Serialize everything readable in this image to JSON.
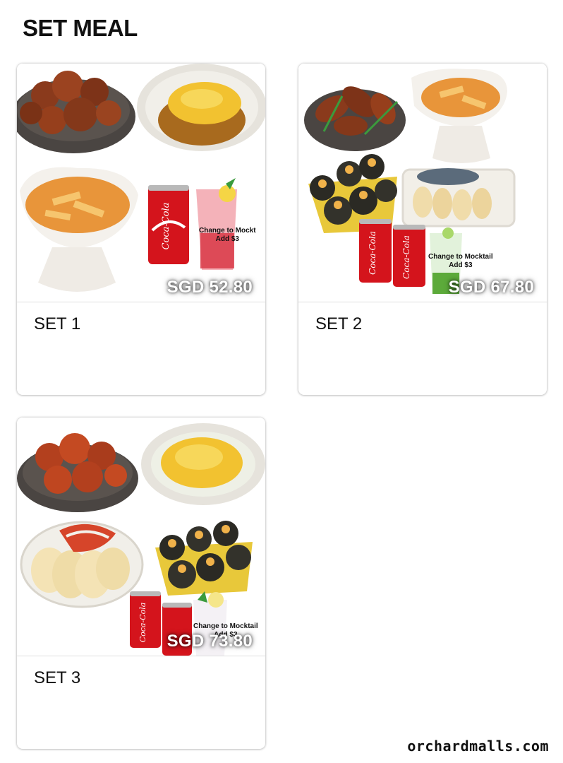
{
  "page": {
    "section_title": "SET MEAL",
    "watermark": "orchardmalls.com"
  },
  "sets": [
    {
      "name": "SET 1",
      "price": "SGD 52.80",
      "mocktail_line1": "Change to Mockt",
      "mocktail_line2": "Add $3",
      "soda_label": "Coca-Cola"
    },
    {
      "name": "SET 2",
      "price": "SGD 67.80",
      "mocktail_line1": "Change to Mocktail",
      "mocktail_line2": "Add $3",
      "soda_label": "Coca-Cola"
    },
    {
      "name": "SET 3",
      "price": "SGD 73.80",
      "mocktail_line1": "Change to Mocktail",
      "mocktail_line2": "Add $3",
      "soda_label": "Coca-Cola"
    }
  ],
  "colors": {
    "fried_chicken": "#8a3a1c",
    "sauce_chicken": "#b3401e",
    "cheese": "#f2c230",
    "curry": "#e8953a",
    "coke_red": "#d4141c",
    "plate_grey": "#e6e3dc",
    "stone_plate": "#4a4542",
    "seaweed": "#2b2a24"
  }
}
